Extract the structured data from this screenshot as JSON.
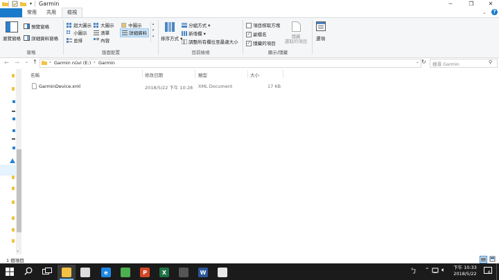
{
  "window": {
    "title": "Garmin",
    "minimize_icon": "─",
    "maximize_icon": "❐",
    "close_icon": "✕"
  },
  "tabs": [
    "常用",
    "共用",
    "檢視"
  ],
  "ribbon": {
    "panes": {
      "nav_pane": "瀏覽窗格",
      "preview_pane": "預覽窗格",
      "details_pane": "詳細資料窗格",
      "group_label": "窗格"
    },
    "layout": {
      "extra_large_icons": "超大圖示",
      "large_icons": "大圖示",
      "medium_icons": "中圖示",
      "small_icons": "小圖示",
      "list": "清單",
      "details": "詳細資料",
      "tiles": "並排",
      "content": "內容",
      "group_label": "版面配置"
    },
    "current_view": {
      "sort_by": "排序方式",
      "group_by": "分組方式",
      "add_columns": "新增欄",
      "size_all_columns": "調整所有欄位至最適大小",
      "group_label": "目前檢視"
    },
    "show_hide": {
      "item_check_boxes": "項目核取方塊",
      "file_name_extensions": "副檔名",
      "hidden_items": "隱藏的項目",
      "hide_selected_items_line1": "隱藏",
      "hide_selected_items_line2": "選取的項目",
      "group_label": "顯示/隱藏",
      "checked": {
        "item_check_boxes": false,
        "file_name_extensions": true,
        "hidden_items": true
      }
    },
    "options": "選項"
  },
  "address": {
    "segments": [
      "Garmin nüvi (E:)",
      "Garmin"
    ],
    "search_placeholder": "搜尋 Garmin"
  },
  "columns": [
    "名稱",
    "修改日期",
    "類型",
    "大小"
  ],
  "files": [
    {
      "name": "GarminDevice.xml",
      "modified": "2018/5/22 下午 10:28",
      "type": "XML Document",
      "size": "17 KB"
    }
  ],
  "status": {
    "item_count": "1 個項目"
  },
  "taskbar": {
    "apps": [
      {
        "name": "file-explorer",
        "glyph": "",
        "color": "#f3c244",
        "active": true
      },
      {
        "name": "store",
        "glyph": "",
        "color": "#dddddd",
        "active": false
      },
      {
        "name": "edge",
        "glyph": "e",
        "color": "#1e88e5",
        "active": false
      },
      {
        "name": "chrome",
        "glyph": "",
        "color": "#4caf50",
        "active": false
      },
      {
        "name": "powerpoint",
        "glyph": "P",
        "color": "#d24726",
        "active": false
      },
      {
        "name": "excel",
        "glyph": "X",
        "color": "#1f7244",
        "active": false
      },
      {
        "name": "calculator",
        "glyph": "",
        "color": "#555555",
        "active": false
      },
      {
        "name": "word",
        "glyph": "W",
        "color": "#2b579a",
        "active": false
      },
      {
        "name": "paint",
        "glyph": "",
        "color": "#e8e8e8",
        "active": false
      }
    ],
    "time": "下午 10:33",
    "date": "2018/5/22",
    "notification_count": "6",
    "tray_glyph_ime": "ㄅ"
  }
}
